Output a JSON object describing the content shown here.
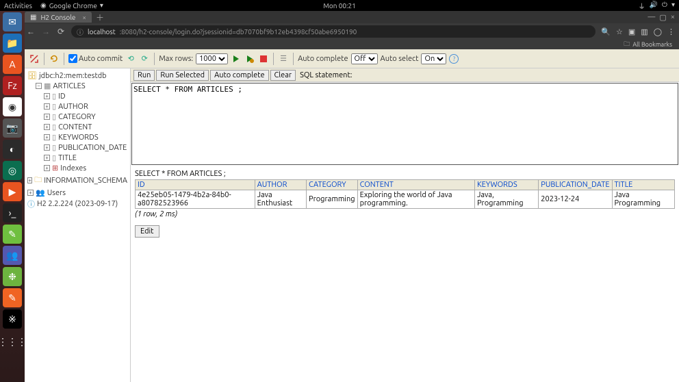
{
  "topbar": {
    "activities": "Activities",
    "app": "Google Chrome",
    "clock": "Mon 00:21"
  },
  "browser": {
    "tab_title": "H2 Console",
    "host": "localhost",
    "path": ":8080/h2-console/login.do?jsessionid=db7070bf9b12eb4398cf50abe6950190",
    "bookmarks_label": "All Bookmarks"
  },
  "toolbar": {
    "autocommit": "Auto commit",
    "maxrows_label": "Max rows:",
    "maxrows_value": "1000",
    "autocomplete_label": "Auto complete",
    "autocomplete_value": "Off",
    "autoselect_label": "Auto select",
    "autoselect_value": "On"
  },
  "tree": {
    "db": "jdbc:h2:mem:testdb",
    "table": "ARTICLES",
    "cols": [
      "ID",
      "AUTHOR",
      "CATEGORY",
      "CONTENT",
      "KEYWORDS",
      "PUBLICATION_DATE",
      "TITLE"
    ],
    "indexes": "Indexes",
    "schema": "INFORMATION_SCHEMA",
    "users": "Users",
    "version": "H2 2.2.224 (2023-09-17)"
  },
  "actions": {
    "run": "Run",
    "run_selected": "Run Selected",
    "auto_complete": "Auto complete",
    "clear": "Clear",
    "sql_label": "SQL statement:"
  },
  "sql": "SELECT * FROM ARTICLES ;",
  "result": {
    "echo": "SELECT * FROM ARTICLES ;",
    "headers": [
      "ID",
      "AUTHOR",
      "CATEGORY",
      "CONTENT",
      "KEYWORDS",
      "PUBLICATION_DATE",
      "TITLE"
    ],
    "row": {
      "id": "4e25eb05-1479-4b2a-84b0-a80782523966",
      "author": "Java Enthusiast",
      "category": "Programming",
      "content": "Exploring the world of Java programming.",
      "keywords": "Java, Programming",
      "pubdate": "2023-12-24",
      "title": "Java Programming"
    },
    "footer": "(1 row, 2 ms)",
    "edit": "Edit"
  }
}
